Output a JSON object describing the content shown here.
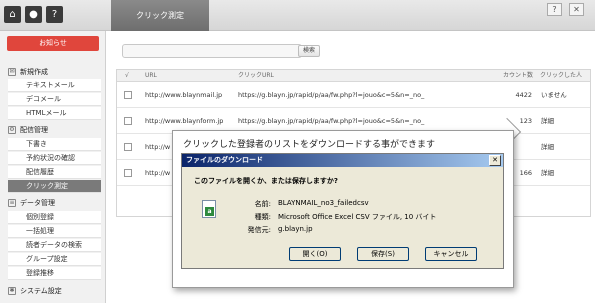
{
  "topbar": {
    "icons": [
      "home-icon",
      "user-icon",
      "help-icon"
    ],
    "active_tab": "クリック測定",
    "help_btn": "?",
    "close_btn": "✕"
  },
  "sidebar": {
    "news_label": "お知らせ",
    "sections": {
      "new": "新規作成",
      "delivery": "配信管理",
      "data": "データ管理",
      "system": "システム設定"
    },
    "items": {
      "text_mail": "テキストメール",
      "deco_mail": "デコメール",
      "html_mail": "HTMLメール",
      "draft": "下書き",
      "reserve": "予約状況の確認",
      "history": "配信履歴",
      "click": "クリック測定",
      "individual": "個別登録",
      "bulk": "一括処理",
      "search": "読者データの検索",
      "group": "グループ設定",
      "trend": "登録推移"
    }
  },
  "search": {
    "placeholder": "",
    "button": "検索"
  },
  "table": {
    "headers": [
      "√",
      "URL",
      "クリックURL",
      "カウント数",
      "クリックした人"
    ],
    "rows": [
      {
        "url": "http://www.blaynmail.jp",
        "click_url": "https://g.blayn.jp/rapid/p/aa/fw.php?l=jouo&c=5&n=_no_",
        "count": "4422",
        "people": "いません"
      },
      {
        "url": "http://www.blaynform.jp",
        "click_url": "https://g.blayn.jp/rapid/p/aa/fw.php?l=jouo&c=5&n=_no_",
        "count": "123",
        "people": "詳細"
      },
      {
        "url": "http://w",
        "click_url": "",
        "count": "",
        "people": "詳細"
      },
      {
        "url": "http://w",
        "click_url": "",
        "count": "166",
        "people": "詳細"
      }
    ]
  },
  "callout": {
    "text": "クリックした登録者のリストをダウンロードする事ができます"
  },
  "dialog": {
    "title": "ファイルのダウンロード",
    "close": "✕",
    "question": "このファイルを開くか、または保存しますか?",
    "name_label": "名前:",
    "name_value": "BLAYNMAIL_no3_failedcsv",
    "type_label": "種類:",
    "type_value": "Microsoft Office Excel CSV ファイル, 10 バイト",
    "from_label": "発信元:",
    "from_value": "g.blayn.jp",
    "open_btn": "開く(O)",
    "save_btn": "保存(S)",
    "cancel_btn": "キャンセル"
  }
}
